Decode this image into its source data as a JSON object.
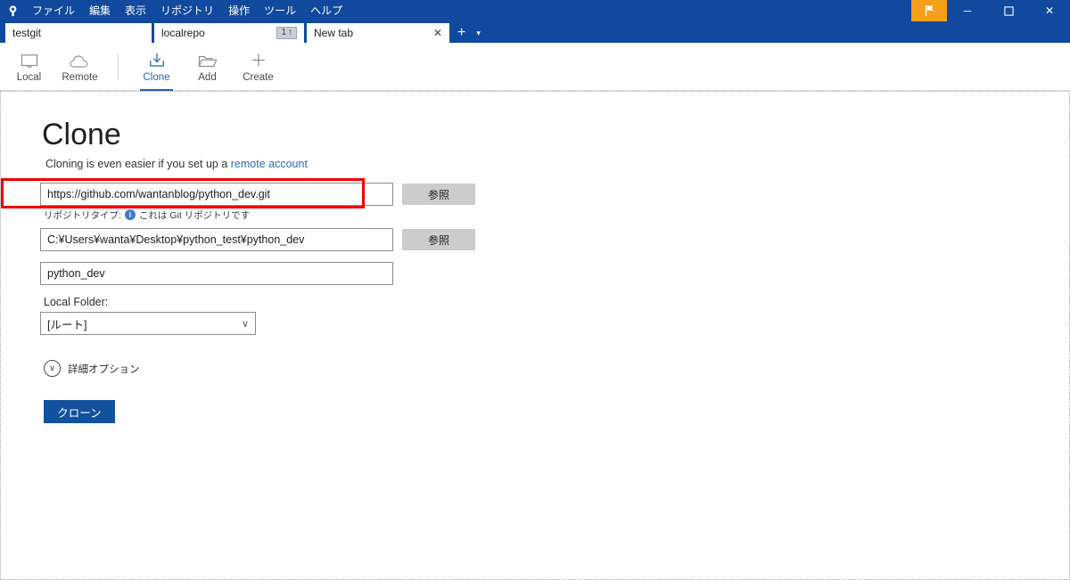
{
  "window": {
    "app_icon": "sourcetree-logo-icon",
    "menu": [
      {
        "label": "ファイル"
      },
      {
        "label": "編集"
      },
      {
        "label": "表示"
      },
      {
        "label": "リポジトリ"
      },
      {
        "label": "操作"
      },
      {
        "label": "ツール"
      },
      {
        "label": "ヘルプ"
      }
    ],
    "controls": {
      "flag": "flag-icon",
      "minimize": "─",
      "maximize": "☐",
      "close": "✕"
    },
    "accent_color": "#11499e",
    "flag_color": "#f5a01a"
  },
  "tabs": {
    "items": [
      {
        "label": "testgit",
        "active": false,
        "badge": ""
      },
      {
        "label": "localrepo",
        "active": false,
        "badge": "1",
        "badge_arrow": "↑"
      },
      {
        "label": "New tab",
        "active": true,
        "close": "✕"
      }
    ],
    "new_tab_button": "+",
    "tab_menu_button": "▾"
  },
  "toolbar": {
    "items": [
      {
        "label": "Local",
        "icon": "monitor-icon",
        "active": false
      },
      {
        "label": "Remote",
        "icon": "cloud-icon",
        "active": false
      },
      {
        "label": "Clone",
        "icon": "clone-download-icon",
        "active": true
      },
      {
        "label": "Add",
        "icon": "folder-icon",
        "active": false
      },
      {
        "label": "Create",
        "icon": "plus-icon",
        "active": false
      }
    ],
    "active_color": "#2060b5"
  },
  "main": {
    "title": "Clone",
    "subtitle_prefix": "Cloning is even easier if you set up a ",
    "subtitle_link": "remote account",
    "source_url": {
      "value": "https://github.com/wantanblog/python_dev.git",
      "browse_label": "参照",
      "highlighted": true
    },
    "repo_type": {
      "prefix": "リポジトリタイプ:",
      "info_icon": "i",
      "text": "これは Git リポジトリです"
    },
    "destination_path": {
      "value": "C:¥Users¥wanta¥Desktop¥python_test¥python_dev",
      "browse_label": "参照"
    },
    "name": {
      "value": "python_dev"
    },
    "local_folder": {
      "label": "Local Folder:",
      "value": "[ルート]",
      "chevron": "∨"
    },
    "advanced": {
      "label": "詳細オプション",
      "chevron": "∨"
    },
    "clone_button": {
      "label": "クローン",
      "color": "#12519e"
    }
  },
  "annotation": {
    "color": "#ee0000"
  }
}
